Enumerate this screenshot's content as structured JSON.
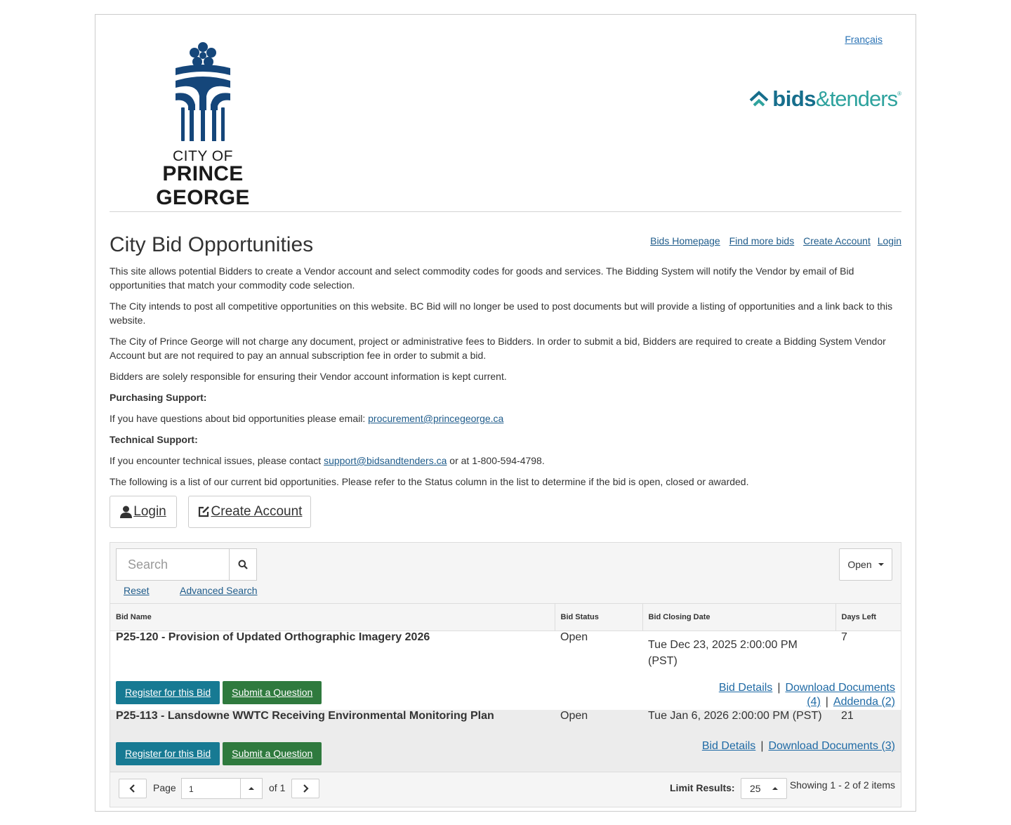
{
  "header": {
    "city_line1": "CITY OF",
    "city_line2": "PRINCE GEORGE",
    "language_link": "Français",
    "bt_bold": "bids",
    "bt_light": "&tenders",
    "bt_tm": "®"
  },
  "title": "City Bid Opportunities",
  "nav_links": [
    "Bids Homepage",
    "Find more bids",
    "Create Account",
    "Login"
  ],
  "intro": {
    "p1": "This site allows potential Bidders to create a Vendor account and  select commodity codes for goods and services. The Bidding System will notify the Vendor by email of Bid opportunities that match your commodity code selection.",
    "p2": "The City intends to post all competitive opportunities on this website. BC Bid will no longer be used to post documents but will provide a listing of opportunities and a link back to this website.",
    "p3": "The City of Prince George will not charge any document, project or administrative fees to Bidders. In order to submit a bid, Bidders are required to create a Bidding System Vendor Account but are not required to pay an annual subscription fee in order to submit a bid.",
    "p4": "Bidders are solely responsible for ensuring their Vendor account information is kept current.",
    "purchasing_heading": "Purchasing Support:",
    "purchasing_text": "If you have questions about bid opportunities please email: ",
    "purchasing_email": "procurement@princegeorge.ca ",
    "technical_heading": "Technical Support:",
    "technical_text_pre": "If you encounter technical issues, please contact ",
    "technical_email": "support@bidsandtenders.ca",
    "technical_text_post": " or at 1-800-594-4798.",
    "list_note": "The following is a list of our current bid opportunities. Please refer to the Status column in the list to determine if the bid is open, closed or awarded."
  },
  "buttons": {
    "login": "Login",
    "create_account": "Create Account"
  },
  "grid": {
    "search_placeholder": "Search",
    "reset": "Reset",
    "advanced_search": "Advanced Search",
    "status_filter": "Open",
    "columns": [
      "Bid Name",
      "Bid Status",
      "Bid Closing Date",
      "Days Left"
    ],
    "rows": [
      {
        "name": "P25-120 - Provision of Updated Orthographic Imagery 2026",
        "status": "Open",
        "closing": "Tue Dec 23, 2025 2:00:00 PM (PST)",
        "days_left": "7",
        "register": "Register for this Bid",
        "question": "Submit a Question",
        "details": "Bid Details",
        "documents": "Download Documents (4)",
        "addenda": "Addenda (2)"
      },
      {
        "name": "P25-113 - Lansdowne WWTC Receiving Environmental Monitoring Plan",
        "status": "Open",
        "closing": "Tue Jan 6, 2026 2:00:00 PM (PST)",
        "days_left": "21",
        "register": "Register for this Bid",
        "question": "Submit a Question",
        "details": "Bid Details",
        "documents": "Download Documents (3)"
      }
    ],
    "pager": {
      "page_label": "Page",
      "page_value": "1",
      "of_label": "of 1",
      "limit_label": "Limit Results:",
      "limit_value": "25",
      "showing": "Showing 1 - 2 of 2 items"
    }
  },
  "colors": {
    "logo_blue": "#15467a",
    "register_button": "#177a93",
    "question_button": "#2f7a3e",
    "link": "#1f5c8b"
  }
}
